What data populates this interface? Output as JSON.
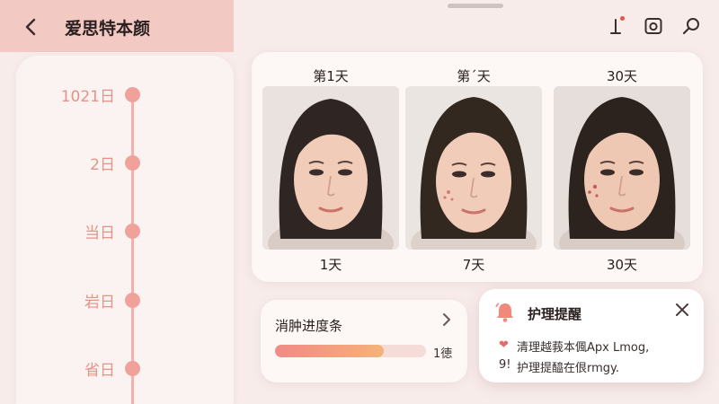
{
  "header": {
    "title": "爱思特本颜",
    "back_icon": "chevron-left-icon",
    "icons": [
      "notification-icon",
      "camera-icon",
      "search-icon"
    ]
  },
  "timeline": {
    "items": [
      {
        "label": "1021日"
      },
      {
        "label": "2日"
      },
      {
        "label": "当日"
      },
      {
        "label": "岩日"
      },
      {
        "label": "省日"
      }
    ]
  },
  "comparison": {
    "photos": [
      {
        "top_label": "第1天",
        "bottom_label": "1天"
      },
      {
        "top_label": "第ˊ天",
        "bottom_label": "7天"
      },
      {
        "top_label": "30天",
        "bottom_label": "30天"
      }
    ]
  },
  "progress": {
    "title": "消肿进度条",
    "value_text": "1徳",
    "fill_fraction": 0.72
  },
  "reminder": {
    "title": "护理提醒",
    "line1": "清理越莪本偑Apx Lmog,",
    "prefix": "9!",
    "line2": "护理提醯在佷rmgy."
  },
  "colors": {
    "accent": "#f0a29a",
    "header_bg": "#f3c9c4",
    "background": "#f7ecea"
  }
}
